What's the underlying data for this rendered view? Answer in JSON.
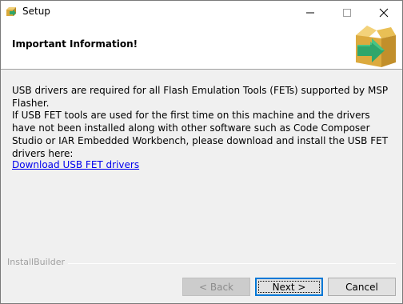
{
  "window": {
    "title": "Setup",
    "controls": {
      "minimize": "minimize-icon",
      "maximize": "maximize-icon",
      "close": "close-icon"
    }
  },
  "header": {
    "title": "Important Information!",
    "logo_icon": "installer-box-arrow-icon"
  },
  "content": {
    "paragraph1": "USB drivers are required for all Flash Emulation Tools (FETs) supported by MSP Flasher.",
    "paragraph2": "If USB FET tools are used for the first time on this machine and the drivers have not been installed along with other software such as Code Composer Studio or IAR Embedded Workbench, please download and install the USB FET drivers here:",
    "link": "Download USB FET drivers"
  },
  "footer": {
    "brand": "InstallBuilder",
    "back_label": "< Back",
    "next_label": "Next >",
    "cancel_label": "Cancel"
  },
  "colors": {
    "link": "#0000ee",
    "focus_border": "#0078d7",
    "logo_box": "#e0b046",
    "logo_arrow": "#2fa66b"
  }
}
